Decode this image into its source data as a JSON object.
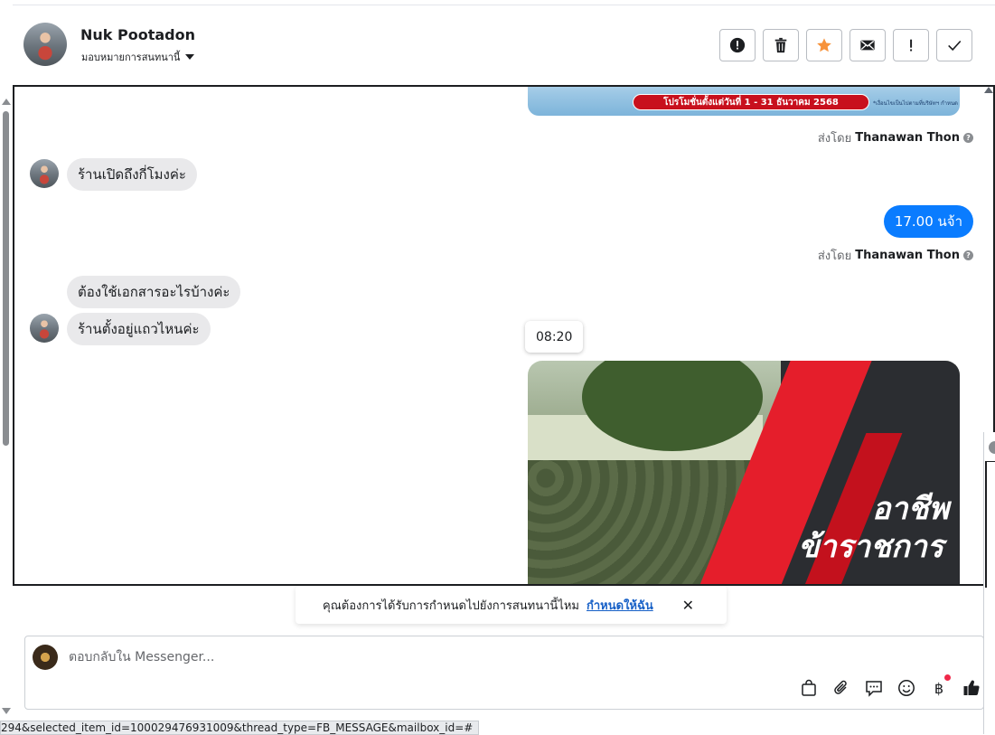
{
  "header": {
    "contact_name": "Nuk Pootadon",
    "assign_label": "มอบหมายการสนทนานี้",
    "actions": [
      {
        "name": "spam-button",
        "icon": "alert-circle-icon"
      },
      {
        "name": "delete-button",
        "icon": "trash-icon"
      },
      {
        "name": "star-button",
        "icon": "star-icon"
      },
      {
        "name": "mark-unread-button",
        "icon": "envelope-icon"
      },
      {
        "name": "follow-up-button",
        "icon": "exclamation-icon"
      },
      {
        "name": "mark-done-button",
        "icon": "check-icon"
      }
    ]
  },
  "conversation": {
    "banner_text": "โปรโมชั่นตั้งแต่วันที่ 1 - 31 ธันวาคม 2568",
    "banner_note": "*เงื่อนไขเป็นไปตามที่บริษัทฯ กำหนด",
    "sent_by_prefix": "ส่งโดย",
    "sender_name": "Thanawan Thon",
    "messages": [
      {
        "direction": "in",
        "text": "ร้านเปิดถึงกี่โมงค่ะ"
      },
      {
        "direction": "out",
        "text": "17.00 นจ้า"
      },
      {
        "direction": "in",
        "text": "ต้องใช้เอกสารอะไรบ้างค่ะ"
      },
      {
        "direction": "in",
        "text": "ร้านตั้งอยู่แถวไหนค่ะ"
      }
    ],
    "timestamp": "08:20",
    "image_text_line1": "อาชีพ",
    "image_text_line2": "ข้าราชการ"
  },
  "prompt": {
    "question": "คุณต้องการได้รับการกำหนดไปยังการสนทนานี้ไหม",
    "action": "กำหนดให้ฉัน",
    "close": "✕"
  },
  "composer": {
    "placeholder": "ตอบกลับใน Messenger...",
    "tools": [
      "shopping-bag-icon",
      "paperclip-icon",
      "saved-replies-icon",
      "emoji-icon",
      "baht-icon",
      "thumbs-up-icon"
    ]
  },
  "status_url": "294&selected_item_id=100029476931009&thread_type=FB_MESSAGE&mailbox_id=#",
  "colors": {
    "accent": "#0a7cff",
    "star": "#f7923a",
    "link": "#1861c7",
    "incoming_bubble": "#e9e9eb"
  }
}
